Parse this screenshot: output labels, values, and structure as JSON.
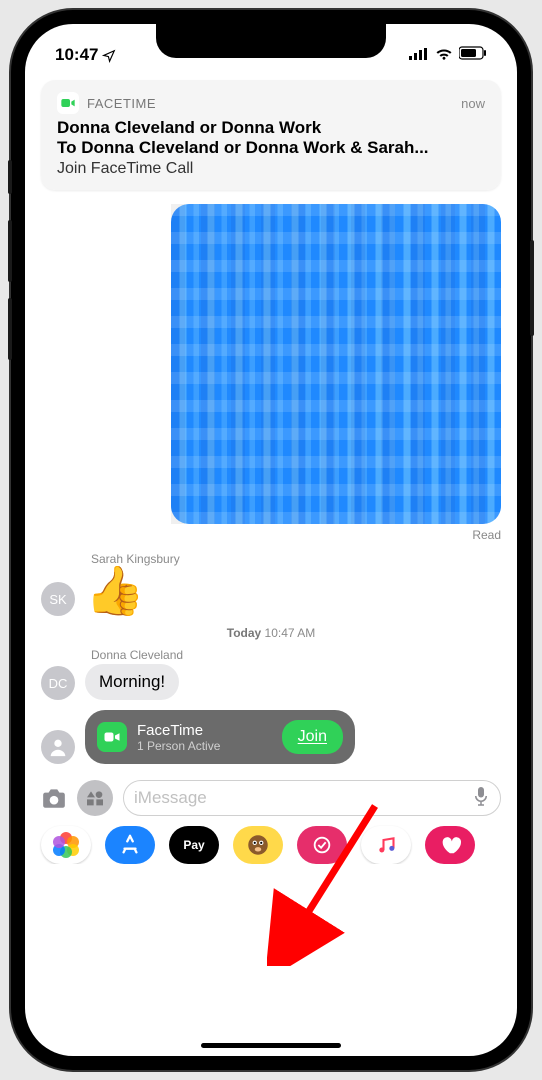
{
  "statusbar": {
    "time": "10:47"
  },
  "notification": {
    "app": "FACETIME",
    "timestamp": "now",
    "title": "Donna Cleveland or Donna Work",
    "subtitle": "To Donna Cleveland or Donna Work & Sarah...",
    "body": "Join FaceTime Call"
  },
  "conversation": {
    "read_receipt": "Read",
    "sender1": "Sarah Kingsbury",
    "sender1_initials": "SK",
    "timestamp_label": "Today",
    "timestamp_time": "10:47 AM",
    "sender2": "Donna Cleveland",
    "sender2_initials": "DC",
    "morning_text": "Morning!",
    "facetime": {
      "title": "FaceTime",
      "subtitle": "1 Person Active",
      "join": "Join"
    }
  },
  "input": {
    "placeholder": "iMessage"
  },
  "apps": {
    "applepay_text": "Pay"
  }
}
